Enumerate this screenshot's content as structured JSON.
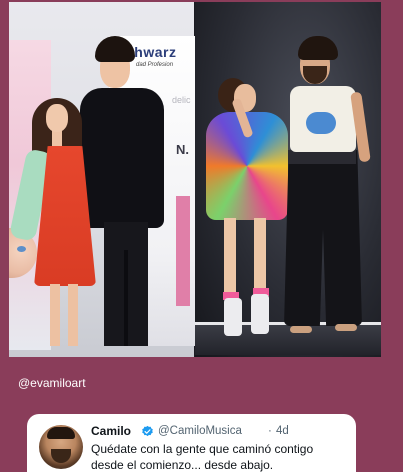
{
  "story": {
    "mention": "@evamiloart"
  },
  "photo_left": {
    "banner_brand": "chwarz",
    "banner_subtitle": "dad Profesion",
    "banner_text": "delic",
    "banner_letters": "N."
  },
  "tweet": {
    "display_name": "Camilo",
    "handle": "@CamiloMusica",
    "separator": "·",
    "time": "4d",
    "text_line1": "Quédate con la gente que caminó contigo",
    "text_line2": "desde el comienzo... desde abajo.",
    "verified_color": "#1d9bf0"
  },
  "icons": {
    "verified": "verified-badge-icon"
  },
  "colors": {
    "story_background": "#8a3d5a",
    "card_background": "#ffffff"
  }
}
